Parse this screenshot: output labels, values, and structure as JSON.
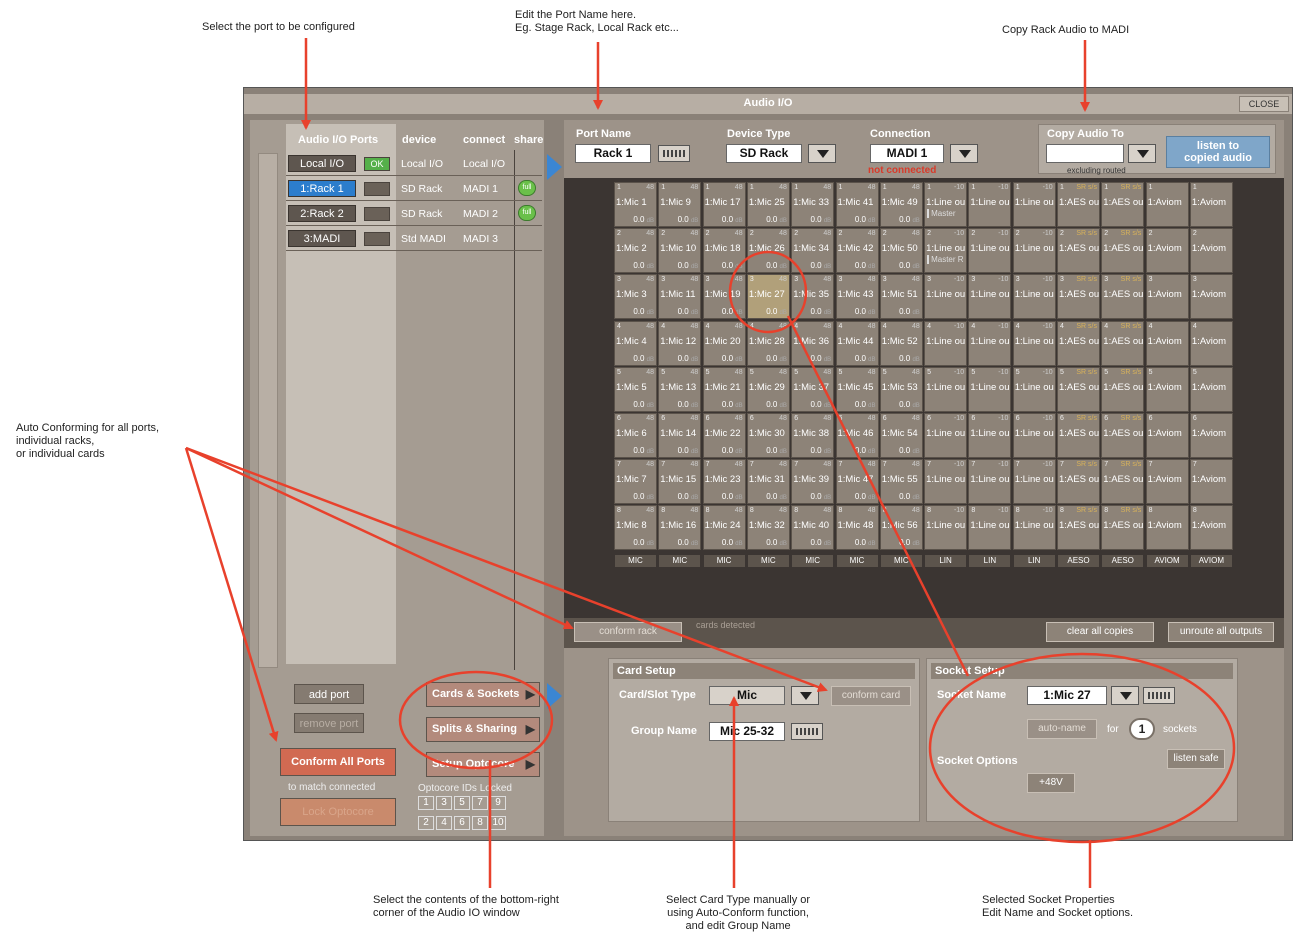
{
  "annotations": {
    "select_port": "Select the port to be configured",
    "edit_port_name": "Edit the Port Name here.\nEg. Stage Rack, Local Rack etc...",
    "copy_rack": "Copy Rack Audio to MADI",
    "auto_conform": "Auto Conforming for all ports,\nindividual racks,\nor individual cards",
    "select_contents": "Select the contents of the bottom-right\ncorner of the Audio IO window",
    "select_card_type": "Select Card Type manually or\nusing Auto-Conform function,\nand edit Group Name",
    "socket_props": "Selected Socket Properties\n    Edit Name and  Socket options."
  },
  "window": {
    "title": "Audio I/O",
    "close_label": "CLOSE"
  },
  "ports": {
    "headers": {
      "ports": "Audio I/O Ports",
      "device": "device",
      "connect": "connect",
      "share": "share"
    },
    "rows": [
      {
        "name": "Local I/O",
        "status": "OK",
        "device": "Local I/O",
        "connect": "Local I/O",
        "share": ""
      },
      {
        "name": "1:Rack 1",
        "status": "",
        "device": "SD Rack",
        "connect": "MADI 1",
        "share": "full"
      },
      {
        "name": "2:Rack 2",
        "status": "",
        "device": "SD Rack",
        "connect": "MADI 2",
        "share": "full"
      },
      {
        "name": "3:MADI",
        "status": "",
        "device": "Std MADI",
        "connect": "MADI 3",
        "share": ""
      }
    ],
    "add_port": "add port",
    "remove_port": "remove port",
    "conform_all": "Conform All Ports",
    "to_match": "to match connected",
    "lock_label": "Lock Optocore"
  },
  "menu": {
    "cards_sockets": "Cards & Sockets",
    "splits_sharing": "Splits & Sharing",
    "setup_optocore": "Setup Optocore",
    "opto_label": "Optocore IDs Locked",
    "opto_ids": [
      "1",
      "3",
      "5",
      "7",
      "9",
      "2",
      "4",
      "6",
      "8",
      "10"
    ]
  },
  "port_config": {
    "port_name_label": "Port Name",
    "port_name": "Rack 1",
    "device_type_label": "Device Type",
    "device_type": "SD Rack",
    "connection_label": "Connection",
    "connection": "MADI 1",
    "connection_status": "not connected",
    "copy_audio_label": "Copy Audio To",
    "copy_audio_value": "",
    "excluding": "excluding routed",
    "listen_copied": "listen to\ncopied audio"
  },
  "grid": {
    "mic_columns": [
      {
        "start": 1,
        "type": "MIC"
      },
      {
        "start": 9,
        "type": "MIC"
      },
      {
        "start": 17,
        "type": "MIC"
      },
      {
        "start": 25,
        "type": "MIC"
      },
      {
        "start": 33,
        "type": "MIC"
      },
      {
        "start": 41,
        "type": "MIC"
      },
      {
        "start": 49,
        "type": "MIC"
      }
    ],
    "mic_gain": "48",
    "mic_db": "0.0",
    "db_unit": "dB",
    "other_columns": [
      {
        "name": "1:Line ou",
        "type": "LIN",
        "gain": "-10"
      },
      {
        "name": "1:Line ou",
        "type": "LIN",
        "gain": "-10"
      },
      {
        "name": "1:Line ou",
        "type": "LIN",
        "gain": "-10"
      },
      {
        "name": "1:AES ou",
        "type": "AESO",
        "gain": "SR s/s"
      },
      {
        "name": "1:AES ou",
        "type": "AESO",
        "gain": "SR s/s"
      },
      {
        "name": "1:Aviom",
        "type": "AVIOM",
        "gain": ""
      },
      {
        "name": "1:Aviom",
        "type": "AVIOM",
        "gain": ""
      }
    ],
    "master_labels": [
      "Master",
      "Master R"
    ],
    "selected_socket": "1:Mic 27"
  },
  "rack_controls": {
    "conform_rack": "conform rack",
    "cards_detected": "cards detected",
    "clear_copies": "clear all copies",
    "unroute_outputs": "unroute all outputs"
  },
  "card_setup": {
    "title": "Card Setup",
    "slot_type_label": "Card/Slot Type",
    "slot_type": "Mic",
    "conform_card": "conform card",
    "group_name_label": "Group Name",
    "group_name": "Mic 25-32"
  },
  "socket_setup": {
    "title": "Socket Setup",
    "socket_name_label": "Socket Name",
    "socket_name": "1:Mic 27",
    "auto_name": "auto-name",
    "for_label": "for",
    "socket_count": "1",
    "sockets_label": "sockets",
    "options_label": "Socket Options",
    "listen_safe": "listen safe",
    "phantom": "+48V"
  }
}
